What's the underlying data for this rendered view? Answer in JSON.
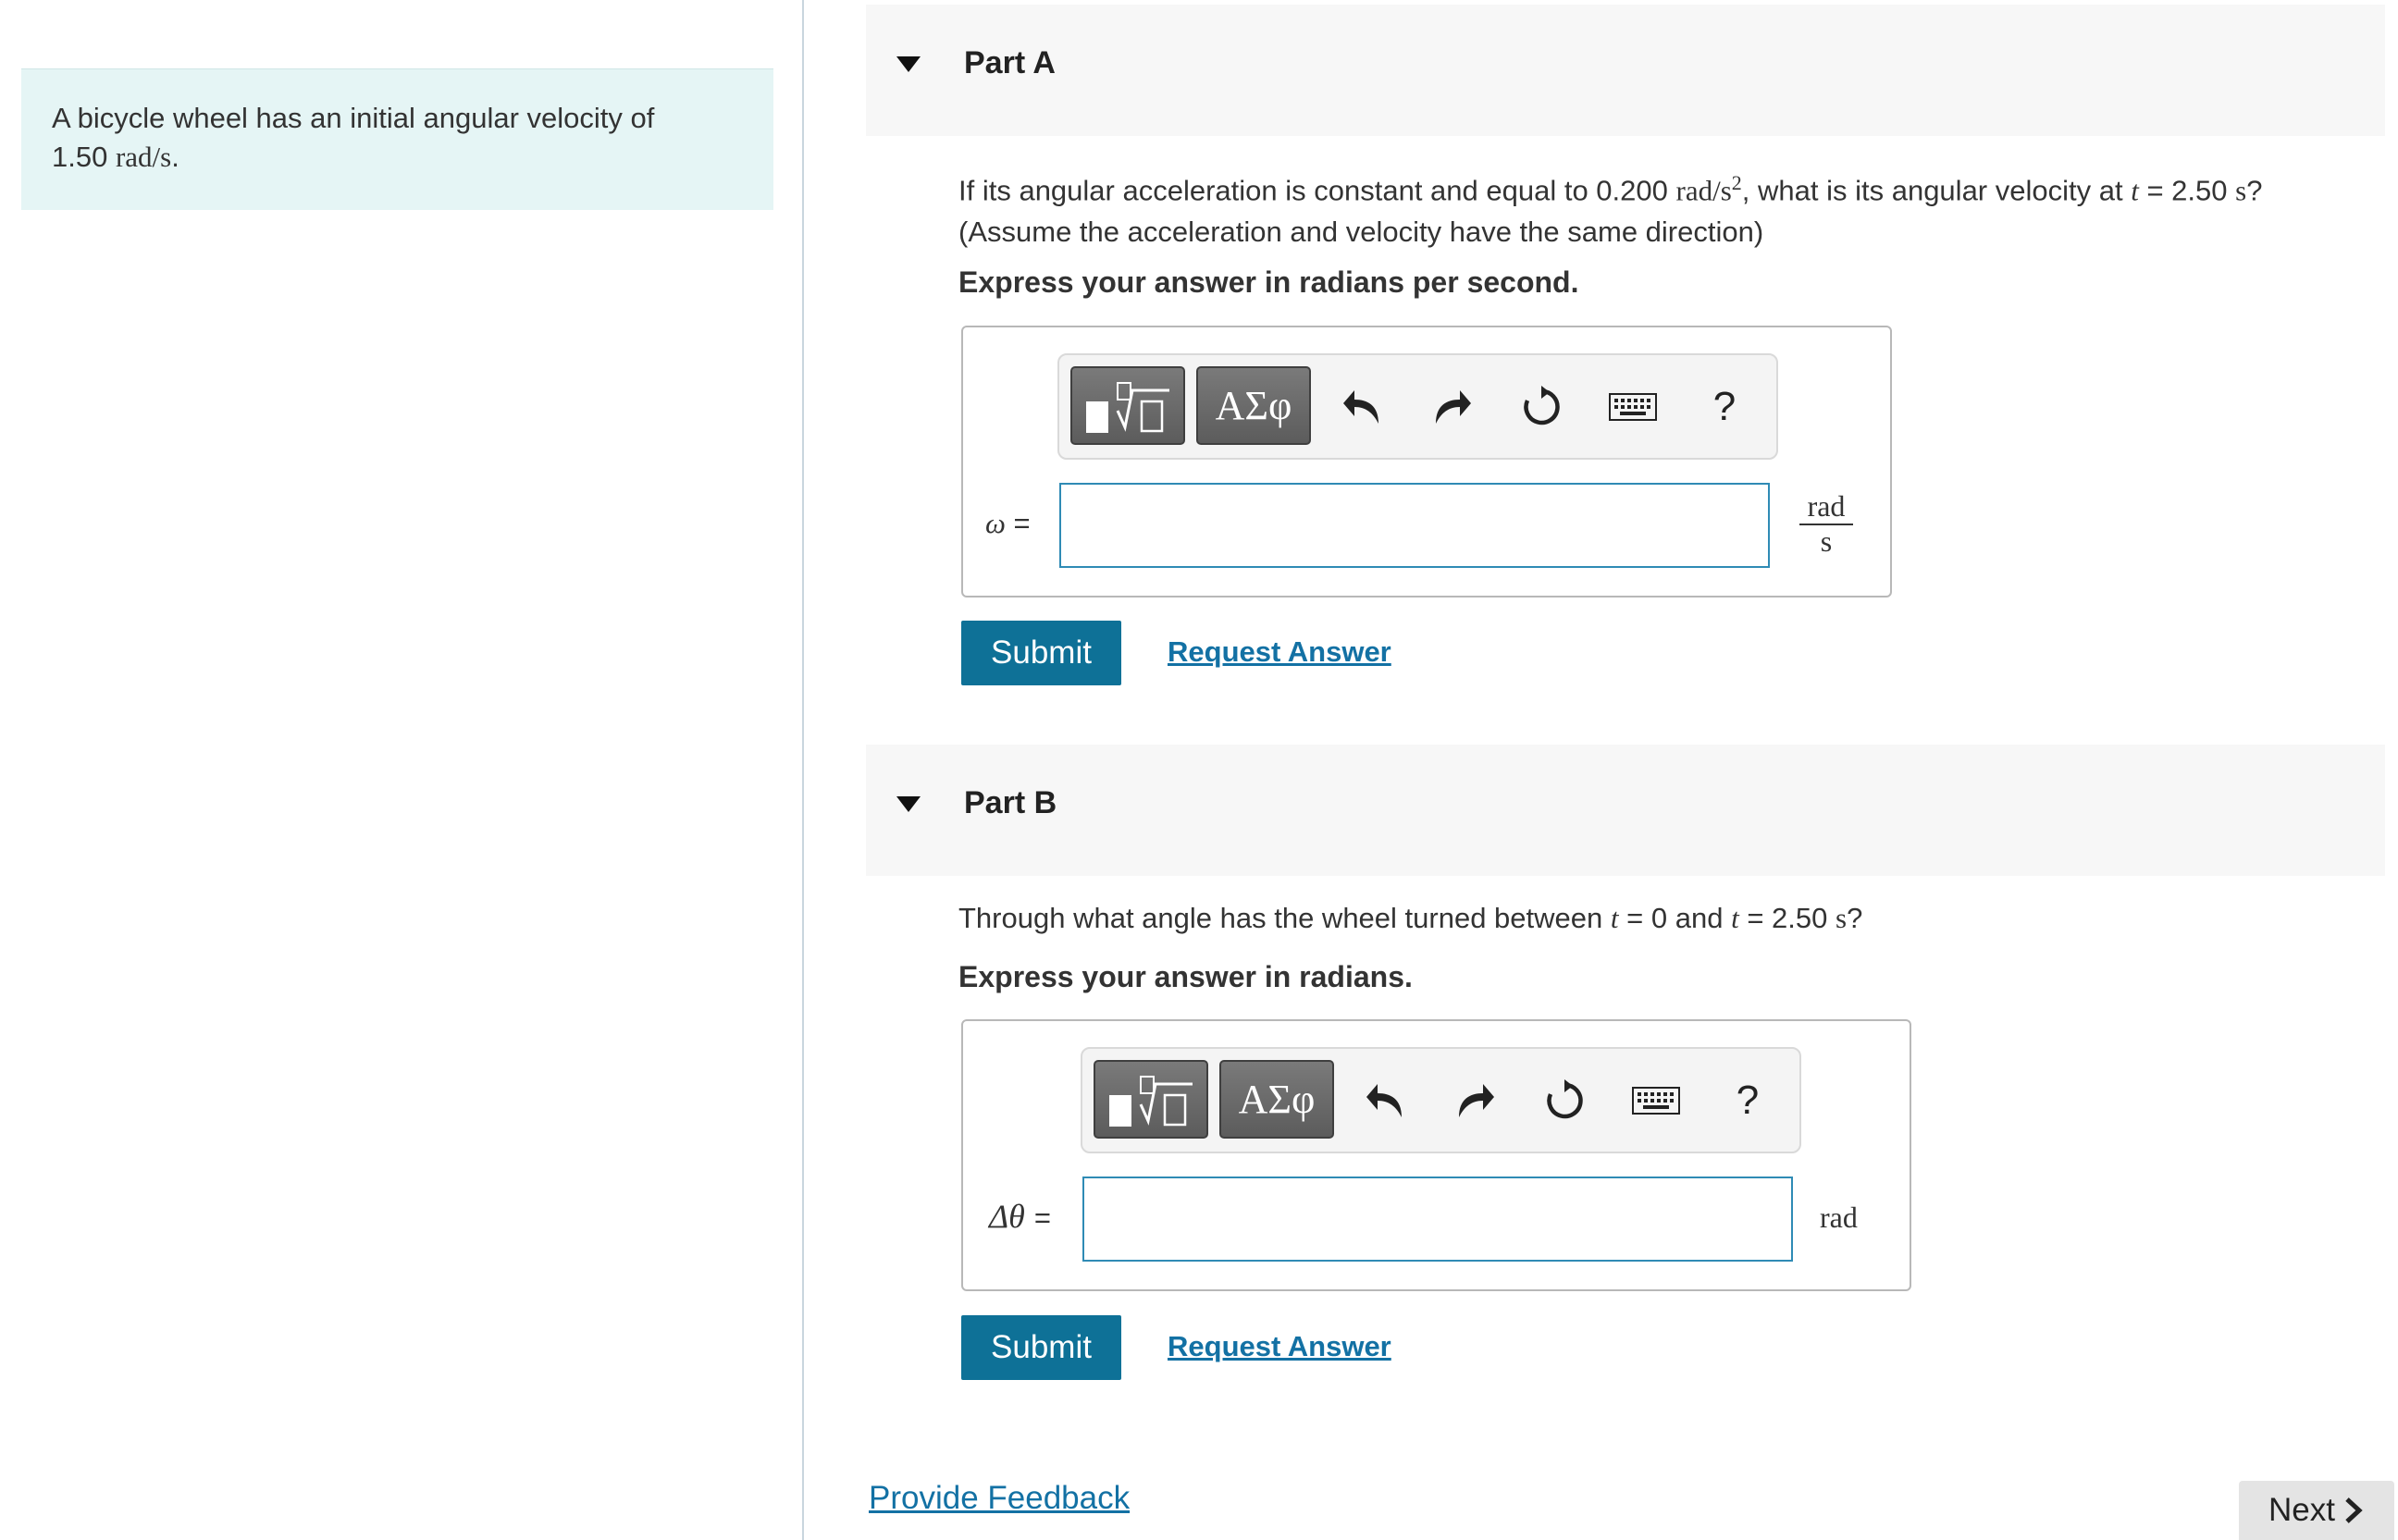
{
  "intro": {
    "text": "A bicycle wheel has an initial angular velocity of",
    "value": "1.50",
    "unit": "rad/s",
    "end": "."
  },
  "partA": {
    "title": "Part A",
    "question": {
      "pre": "If its angular acceleration is constant and equal to 0.200",
      "unit1": "rad/s",
      "sup": "2",
      "mid": ", what is its angular velocity at",
      "var": "t",
      "eq": "= 2.50",
      "unit2": "s",
      "end": "?",
      "line2": "(Assume the acceleration and velocity have the same direction)"
    },
    "instruction": "Express your answer in radians per second.",
    "toolbar": {
      "greek_label": "ΑΣφ",
      "help_label": "?"
    },
    "input": {
      "var": "ω",
      "eq": "=",
      "value": "",
      "unit_num": "rad",
      "unit_den": "s"
    },
    "submit_label": "Submit",
    "request_label": "Request Answer"
  },
  "partB": {
    "title": "Part B",
    "question": {
      "pre": "Through what angle has the wheel turned between",
      "var1": "t",
      "mid": "= 0 and",
      "var2": "t",
      "eq": "= 2.50",
      "unit": "s",
      "end": "?"
    },
    "instruction": "Express your answer in radians.",
    "toolbar": {
      "greek_label": "ΑΣφ",
      "help_label": "?"
    },
    "input": {
      "var": "Δθ",
      "eq": "=",
      "value": "",
      "unit": "rad"
    },
    "submit_label": "Submit",
    "request_label": "Request Answer"
  },
  "footer": {
    "feedback_label": "Provide Feedback",
    "next_label": "Next"
  },
  "colors": {
    "accent": "#0e7197",
    "link": "#1371a4",
    "intro_bg": "#e5f5f5",
    "input_border": "#2f8bb5"
  }
}
